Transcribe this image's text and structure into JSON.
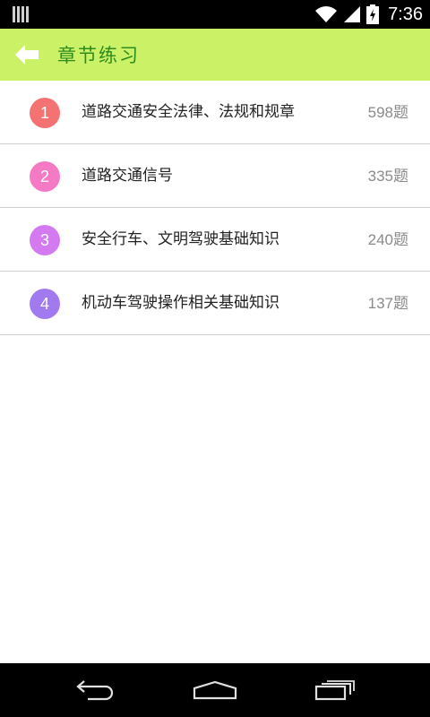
{
  "status": {
    "time": "7:36"
  },
  "header": {
    "title": "章节练习"
  },
  "chapters": [
    {
      "number": "1",
      "title": "道路交通安全法律、法规和规章",
      "count": "598题",
      "color": "#f47272"
    },
    {
      "number": "2",
      "title": "道路交通信号",
      "count": "335题",
      "color": "#f47ac6"
    },
    {
      "number": "3",
      "title": "安全行车、文明驾驶基础知识",
      "count": "240题",
      "color": "#d47af0"
    },
    {
      "number": "4",
      "title": "机动车驾驶操作相关基础知识",
      "count": "137题",
      "color": "#a17af0"
    }
  ],
  "icons": {
    "back": "arrow-left-icon",
    "nav_back": "nav-back-icon",
    "nav_home": "nav-home-icon",
    "nav_recents": "nav-recents-icon"
  },
  "colors": {
    "app_bar": "#cbf267",
    "title": "#2e8b1e",
    "count": "#8a8a8a"
  }
}
